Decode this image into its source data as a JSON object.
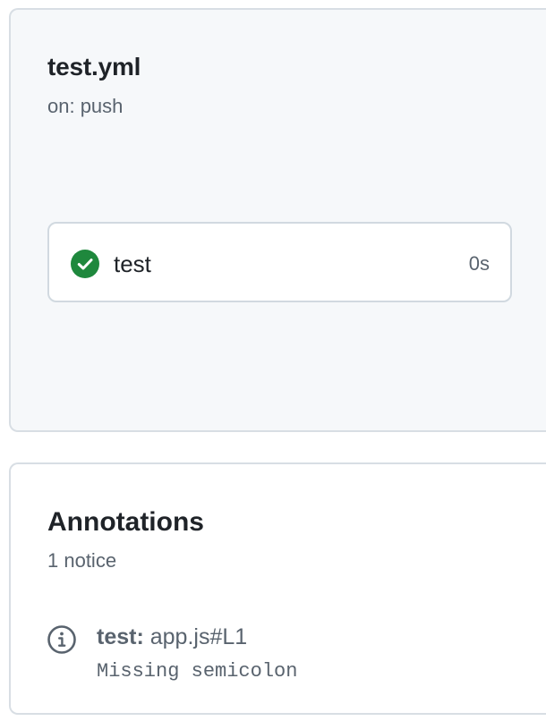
{
  "workflow": {
    "title": "test.yml",
    "trigger": "on: push",
    "jobs": [
      {
        "name": "test",
        "status": "success",
        "status_icon": "check-circle-fill-icon",
        "duration": "0s"
      }
    ]
  },
  "annotations": {
    "title": "Annotations",
    "count_label": "1 notice",
    "items": [
      {
        "icon": "info-icon",
        "job": "test:",
        "location": "app.js#L1",
        "message": "Missing semicolon"
      }
    ]
  },
  "colors": {
    "success": "#1f883d",
    "panel_background": "#f6f8fa",
    "border": "#d8dee4",
    "text_primary": "#1f2328",
    "text_muted": "#59636e"
  }
}
